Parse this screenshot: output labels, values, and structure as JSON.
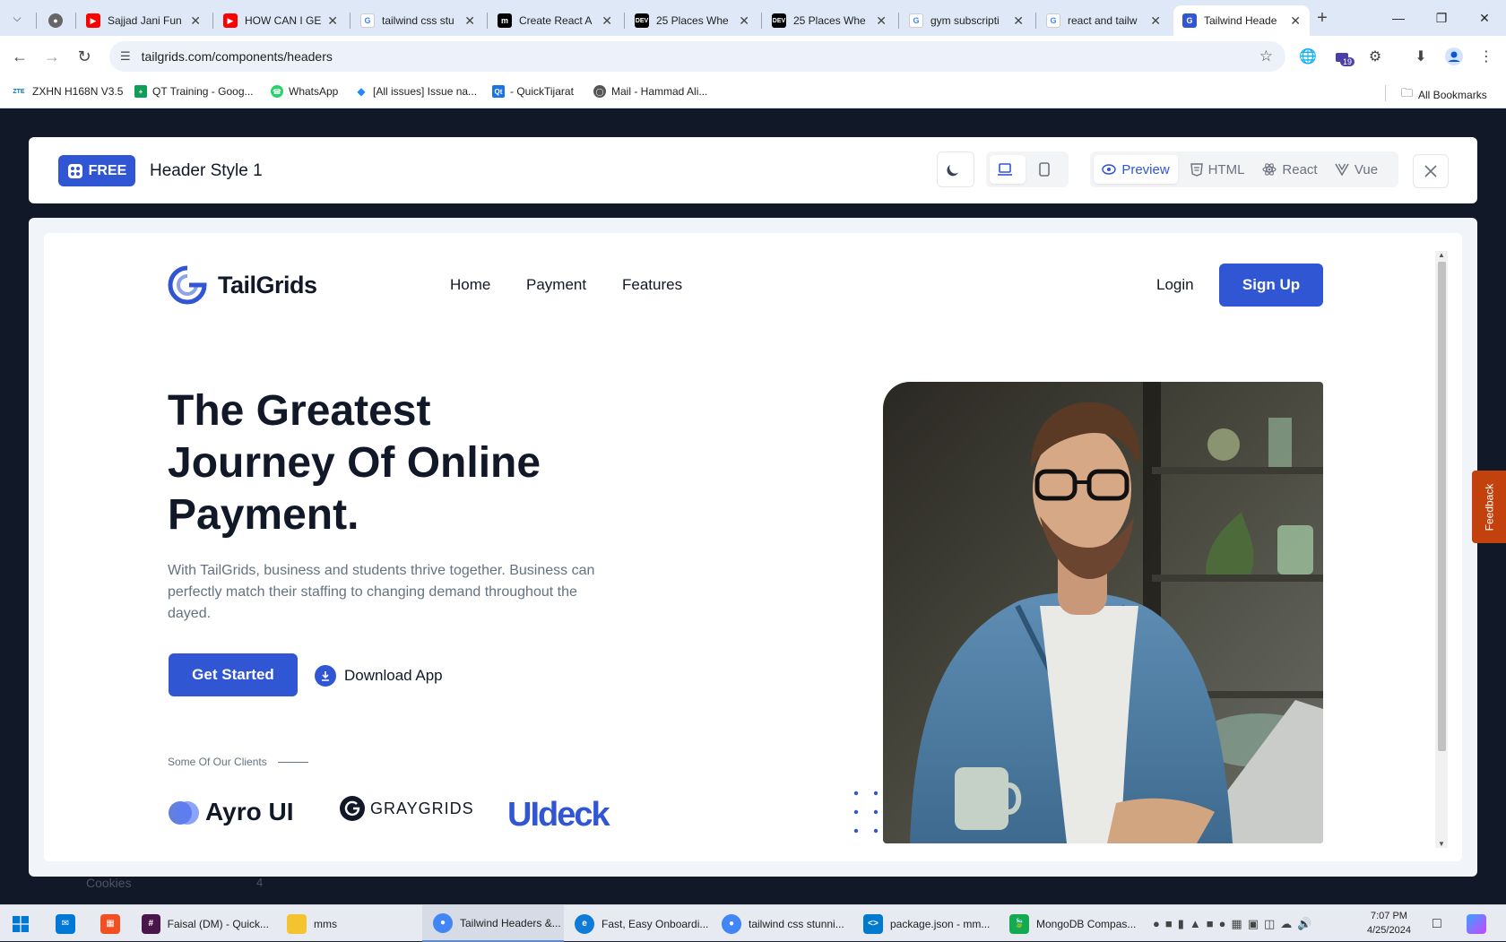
{
  "browser": {
    "tabs": [
      {
        "title": "Sajjad Jani Fun",
        "favicon": "youtube-icon",
        "color": "#ff0000"
      },
      {
        "title": "HOW CAN I GE",
        "favicon": "youtube-icon",
        "color": "#ff0000"
      },
      {
        "title": "tailwind css stu",
        "favicon": "google-icon",
        "color": "#4285f4"
      },
      {
        "title": "Create React A",
        "favicon": "medium-icon",
        "color": "#000000"
      },
      {
        "title": "25 Places Whe",
        "favicon": "dev-icon",
        "color": "#000000"
      },
      {
        "title": "25 Places Whe",
        "favicon": "dev-icon",
        "color": "#000000"
      },
      {
        "title": "gym subscripti",
        "favicon": "google-icon",
        "color": "#4285f4"
      },
      {
        "title": "react and tailw",
        "favicon": "google-icon",
        "color": "#4285f4"
      },
      {
        "title": "Tailwind Heade",
        "favicon": "tailgrids-icon",
        "color": "#3056d3",
        "active": true
      }
    ],
    "url": "tailgrids.com/components/headers",
    "extension_badge": "19",
    "bookmarks": [
      {
        "label": "ZXHN H168N V3.5",
        "icon": "zte-icon",
        "icon_text": "ZTE",
        "color": "#0077c8"
      },
      {
        "label": "QT Training - Goog...",
        "icon": "sheets-icon",
        "icon_text": "+",
        "color": "#0f9d58"
      },
      {
        "label": "WhatsApp",
        "icon": "whatsapp-icon",
        "icon_text": "",
        "color": "#25d366"
      },
      {
        "label": "[All issues] Issue na...",
        "icon": "jira-icon",
        "icon_text": "",
        "color": "#2684ff"
      },
      {
        "label": "- QuickTijarat",
        "icon": "qt-icon",
        "icon_text": "Qt",
        "color": "#1a73e8"
      },
      {
        "label": "Mail - Hammad Ali...",
        "icon": "globe-icon",
        "icon_text": "",
        "color": "#555555"
      }
    ],
    "all_bookmarks": "All Bookmarks"
  },
  "modal": {
    "badge": "FREE",
    "title": "Header Style 1",
    "tabs": [
      {
        "label": "Preview",
        "icon": "eye-icon",
        "active": true
      },
      {
        "label": "HTML",
        "icon": "html-icon",
        "active": false
      },
      {
        "label": "React",
        "icon": "react-icon",
        "active": false
      },
      {
        "label": "Vue",
        "icon": "vue-icon",
        "active": false
      }
    ]
  },
  "site": {
    "brand": "TailGrids",
    "nav": [
      "Home",
      "Payment",
      "Features"
    ],
    "login": "Login",
    "signup": "Sign Up",
    "hero_title": "The Greatest Journey Of Online Payment.",
    "hero_text": "With TailGrids, business and students thrive together. Business can perfectly match their staffing to changing demand throughout the dayed.",
    "cta_primary": "Get Started",
    "cta_secondary": "Download App",
    "clients_label": "Some Of Our Clients",
    "clients": [
      "Ayro UI",
      "GRAYGRIDS",
      "UIdeck"
    ],
    "accent": "#3056d3"
  },
  "background_page": {
    "sidebar_item": "Cookies",
    "sidebar_count": "4"
  },
  "feedback": "Feedback",
  "taskbar": {
    "apps": [
      {
        "label": "Faisal (DM) - Quick...",
        "icon": "slack-icon",
        "color": "#4a154b"
      },
      {
        "label": "mms",
        "icon": "folder-icon",
        "color": "#f4c430"
      },
      {
        "label": "Tailwind Headers &...",
        "icon": "chrome-icon",
        "color": "#4285f4",
        "active": true
      },
      {
        "label": "Fast, Easy Onboardi...",
        "icon": "edge-icon",
        "color": "#0f7bd8"
      },
      {
        "label": "tailwind css stunni...",
        "icon": "chrome-icon",
        "color": "#4285f4"
      },
      {
        "label": "package.json - mm...",
        "icon": "vscode-icon",
        "color": "#007acc"
      },
      {
        "label": "MongoDB Compas...",
        "icon": "mongodb-icon",
        "color": "#13aa52"
      }
    ],
    "time": "7:07 PM",
    "date": "4/25/2024"
  }
}
